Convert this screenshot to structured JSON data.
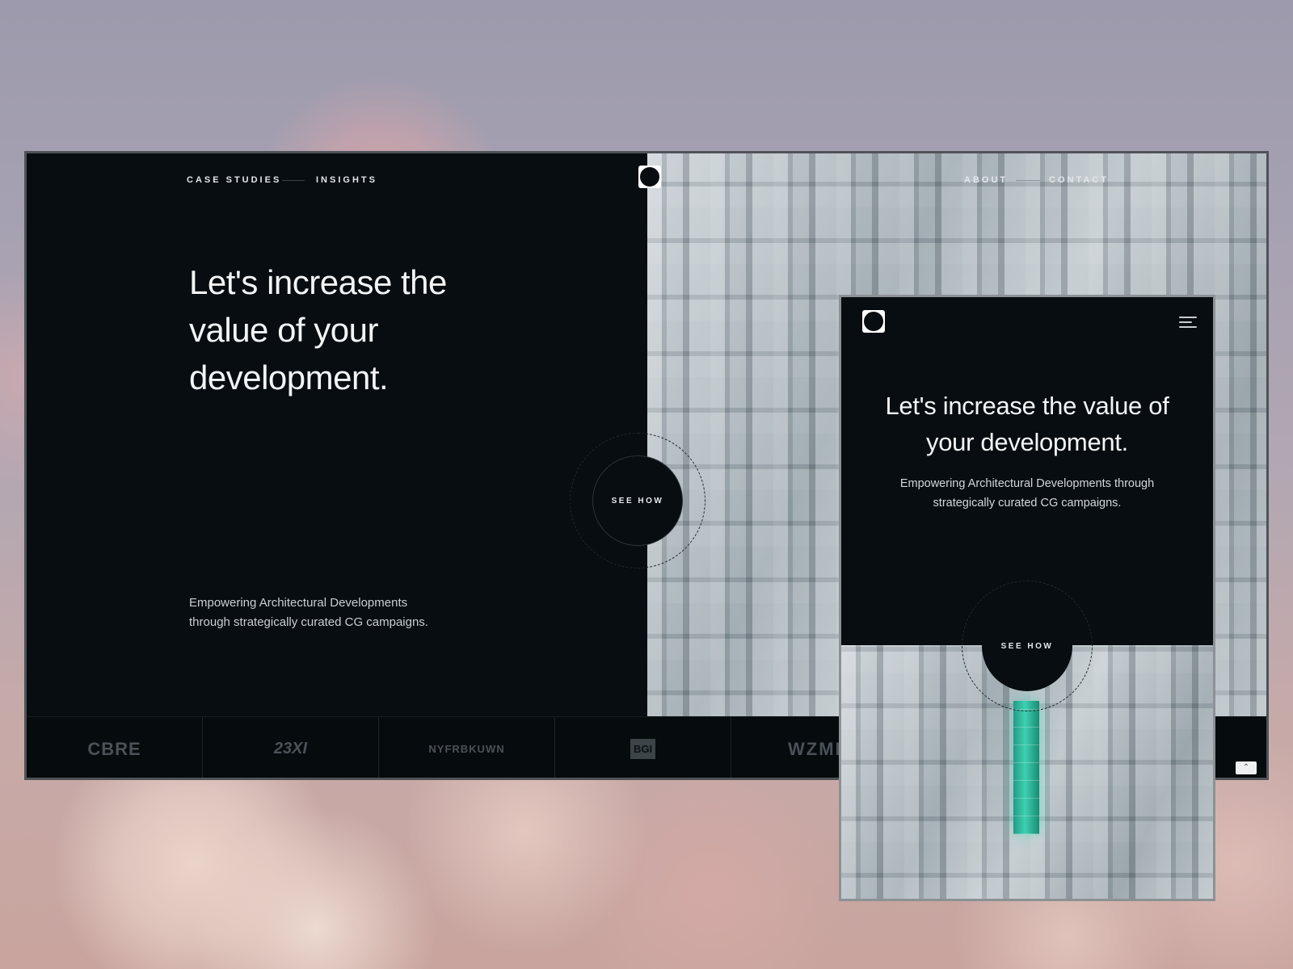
{
  "desktop": {
    "nav_left": [
      "CASE STUDIES",
      "INSIGHTS"
    ],
    "nav_right": [
      "ABOUT",
      "CONTACT"
    ],
    "hero_title": "Let's increase the value of your development.",
    "hero_subtitle": "Empowering Architectural Developments through strategically curated CG campaigns.",
    "cta_label": "SEE HOW",
    "client_logos": [
      "CBRE",
      "23XI",
      "NYFRBKUWN",
      "BGI",
      "WZMI"
    ]
  },
  "mobile": {
    "hero_title": "Let's increase the value of your development.",
    "hero_subtitle": "Empowering Architectural Developments through strategically curated CG campaigns.",
    "cta_label": "SEE HOW"
  },
  "colors": {
    "panel": "#070d11",
    "text": "#f2f4f5",
    "accent": "#3fd0b1"
  },
  "icons": {
    "logo": "circle-in-square-logo-icon",
    "menu": "hamburger-menu-icon",
    "scroll_top": "chevron-up-icon"
  }
}
